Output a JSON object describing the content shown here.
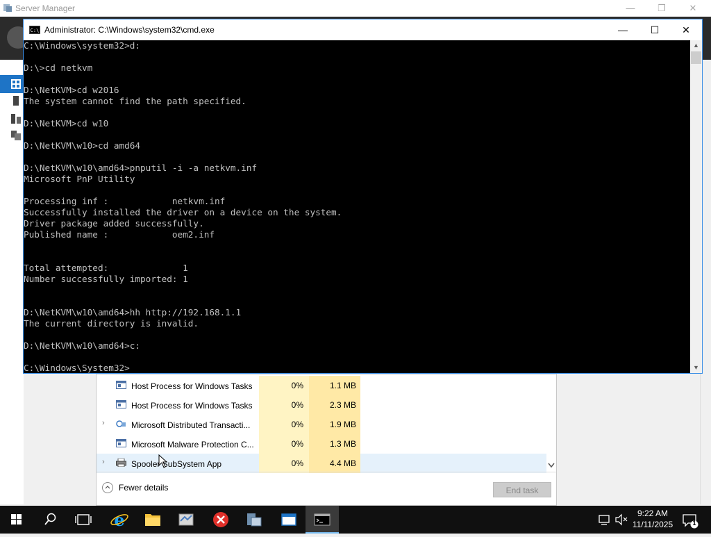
{
  "server_manager": {
    "title": "Server Manager",
    "minimize": "—",
    "restore": "❐",
    "close": "✕"
  },
  "cmd": {
    "title": "Administrator: C:\\Windows\\system32\\cmd.exe",
    "minimize": "—",
    "maximize": "☐",
    "close": "✕",
    "lines": [
      "C:\\Windows\\system32>d:",
      "",
      "D:\\>cd netkvm",
      "",
      "D:\\NetKVM>cd w2016",
      "The system cannot find the path specified.",
      "",
      "D:\\NetKVM>cd w10",
      "",
      "D:\\NetKVM\\w10>cd amd64",
      "",
      "D:\\NetKVM\\w10\\amd64>pnputil -i -a netkvm.inf",
      "Microsoft PnP Utility",
      "",
      "Processing inf :            netkvm.inf",
      "Successfully installed the driver on a device on the system.",
      "Driver package added successfully.",
      "Published name :            oem2.inf",
      "",
      "",
      "Total attempted:              1",
      "Number successfully imported: 1",
      "",
      "",
      "D:\\NetKVM\\w10\\amd64>hh http://192.168.1.1",
      "The current directory is invalid.",
      "",
      "D:\\NetKVM\\w10\\amd64>c:",
      "",
      "C:\\Windows\\System32>"
    ]
  },
  "task_manager": {
    "rows": [
      {
        "name": "Host Process for Windows Tasks",
        "cpu": "0%",
        "mem": "1.1 MB",
        "expandable": false
      },
      {
        "name": "Host Process for Windows Tasks",
        "cpu": "0%",
        "mem": "2.3 MB",
        "expandable": false
      },
      {
        "name": "Microsoft Distributed Transacti...",
        "cpu": "0%",
        "mem": "1.9 MB",
        "expandable": true
      },
      {
        "name": "Microsoft Malware Protection C...",
        "cpu": "0%",
        "mem": "1.3 MB",
        "expandable": false
      },
      {
        "name": "Spooler SubSystem App",
        "cpu": "0%",
        "mem": "4.4 MB",
        "expandable": true
      }
    ],
    "fewer_details": "Fewer details",
    "end_task": "End task"
  },
  "taskbar": {
    "time": "9:22 AM",
    "date": "11/11/2025",
    "notifications_count": "1"
  }
}
